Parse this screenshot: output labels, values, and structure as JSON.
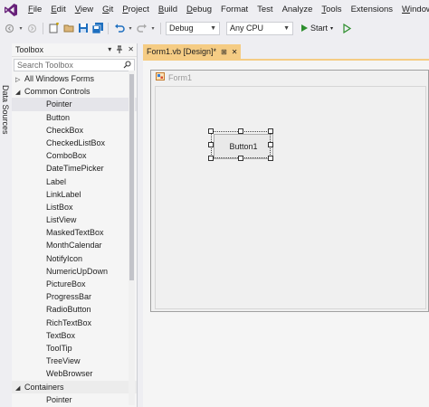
{
  "menu": {
    "items": [
      {
        "label": "File",
        "accel": "F",
        "rest": "ile"
      },
      {
        "label": "Edit",
        "accel": "E",
        "rest": "dit"
      },
      {
        "label": "View",
        "accel": "V",
        "rest": "iew"
      },
      {
        "label": "Git",
        "accel": "G",
        "rest": "it"
      },
      {
        "label": "Project",
        "accel": "P",
        "rest": "roject"
      },
      {
        "label": "Build",
        "accel": "B",
        "rest": "uild"
      },
      {
        "label": "Debug",
        "accel": "D",
        "rest": "ebug"
      },
      {
        "label": "Format",
        "accel": "F",
        "rest": "ormat"
      },
      {
        "label": "Test",
        "accel": "s",
        "rest": "Te|t"
      },
      {
        "label": "Analyze",
        "accel": "n",
        "rest": "A|alyze"
      },
      {
        "label": "Tools",
        "accel": "T",
        "rest": "ools"
      },
      {
        "label": "Extensions",
        "accel": "x",
        "rest": "E|tensions"
      },
      {
        "label": "Window",
        "accel": "W",
        "rest": "indow"
      }
    ]
  },
  "toolbar": {
    "configuration": "Debug",
    "platform": "Any CPU",
    "start_label": "Start"
  },
  "side_tab": {
    "label": "Data Sources"
  },
  "toolbox": {
    "title": "Toolbox",
    "search_placeholder": "Search Toolbox",
    "groups": [
      {
        "label": "All Windows Forms",
        "expanded": false
      },
      {
        "label": "Common Controls",
        "expanded": true,
        "items": [
          "Pointer",
          "Button",
          "CheckBox",
          "CheckedListBox",
          "ComboBox",
          "DateTimePicker",
          "Label",
          "LinkLabel",
          "ListBox",
          "ListView",
          "MaskedTextBox",
          "MonthCalendar",
          "NotifyIcon",
          "NumericUpDown",
          "PictureBox",
          "ProgressBar",
          "RadioButton",
          "RichTextBox",
          "TextBox",
          "ToolTip",
          "TreeView",
          "WebBrowser"
        ],
        "selected": "Pointer"
      },
      {
        "label": "Containers",
        "expanded": true,
        "items": [
          "Pointer"
        ]
      }
    ]
  },
  "document": {
    "tab_label": "Form1.vb [Design]*"
  },
  "form": {
    "title": "Form1",
    "button_label": "Button1"
  },
  "colors": {
    "accent_tab": "#f5cc84",
    "start_green": "#2d8e2d",
    "vs_purple": "#68217a"
  }
}
